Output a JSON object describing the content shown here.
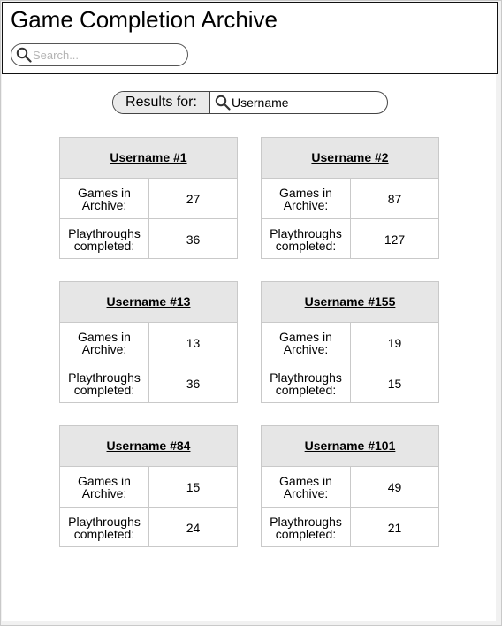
{
  "header": {
    "title": "Game Completion Archive",
    "search_placeholder": "Search...",
    "search_icon": "search-icon"
  },
  "results": {
    "label": "Results for:",
    "query": "Username",
    "search_icon": "search-icon"
  },
  "labels": {
    "games": "Games in Archive:",
    "playthroughs": "Playthroughs completed:"
  },
  "cards": [
    {
      "name": "Username #1",
      "games": "27",
      "playthroughs": "36"
    },
    {
      "name": "Username #2",
      "games": "87",
      "playthroughs": "127"
    },
    {
      "name": "Username #13",
      "games": "13",
      "playthroughs": "36"
    },
    {
      "name": "Username #155",
      "games": "19",
      "playthroughs": "15"
    },
    {
      "name": "Username #84",
      "games": "15",
      "playthroughs": "24"
    },
    {
      "name": "Username #101",
      "games": "49",
      "playthroughs": "21"
    }
  ]
}
